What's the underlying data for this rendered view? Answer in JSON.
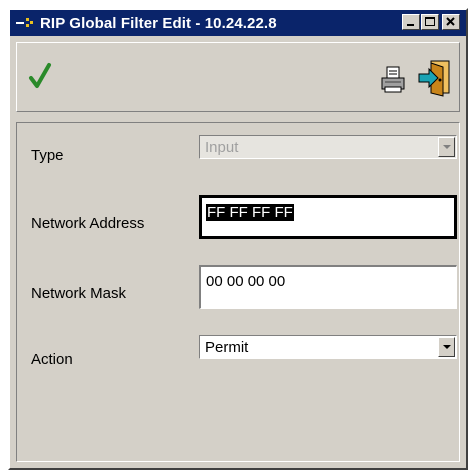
{
  "window": {
    "title": "RIP Global Filter Edit - 10.24.22.8",
    "controls": {
      "minimize_icon": "minimize-icon",
      "maximize_icon": "maximize-icon",
      "close_icon": "close-icon"
    }
  },
  "toolbar": {
    "apply_icon": "checkmark-icon",
    "print_icon": "printer-icon",
    "exit_icon": "exit-door-icon"
  },
  "form": {
    "type_label": "Type",
    "type_value": "Input",
    "network_address_label": "Network Address",
    "network_address_value": "FF FF FF FF",
    "network_mask_label": "Network Mask",
    "network_mask_value": "00 00 00 00",
    "action_label": "Action",
    "action_value": "Permit"
  },
  "colors": {
    "titlebar": "#0a246a",
    "face": "#d4d0c8",
    "check": "#2a8a2a",
    "door": "#c8841a",
    "exit_arrow": "#1aa3b4"
  }
}
